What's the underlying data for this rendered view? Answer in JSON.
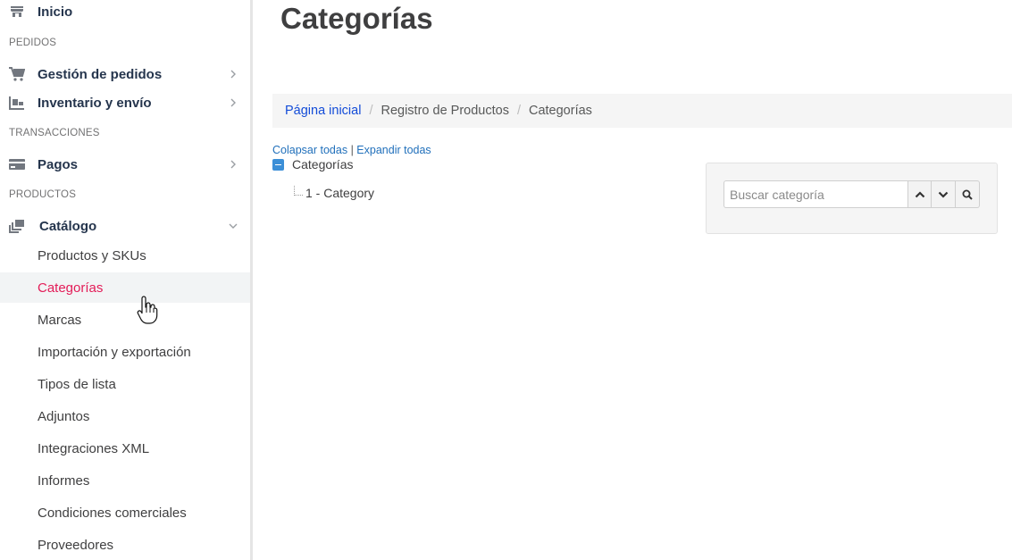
{
  "sidebar": {
    "home_label": "Inicio",
    "section_orders": "PEDIDOS",
    "orders_label": "Gestión de pedidos",
    "inventory_label": "Inventario y envío",
    "section_transactions": "TRANSACCIONES",
    "payments_label": "Pagos",
    "section_products": "PRODUCTOS",
    "catalog_label": "Catálogo",
    "catalog_items": [
      "Productos y SKUs",
      "Categorías",
      "Marcas",
      "Importación y exportación",
      "Tipos de lista",
      "Adjuntos",
      "Integraciones XML",
      "Informes",
      "Condiciones comerciales",
      "Proveedores"
    ],
    "active_item": "Categorías"
  },
  "page": {
    "title": "Categorías"
  },
  "breadcrumb": {
    "home": "Página inicial",
    "level1": "Registro de Productos",
    "current": "Categorías",
    "separator": "/"
  },
  "tree": {
    "collapse_all": "Colapsar todas",
    "divider": "|",
    "expand_all": "Expandir todas",
    "root_label": "Categorías",
    "children": [
      "1 - Category"
    ]
  },
  "search": {
    "placeholder": "Buscar categoría"
  },
  "colors": {
    "active_text": "#e31c58",
    "link": "#134cd8",
    "tree_toggle": "#3c8fd7"
  }
}
